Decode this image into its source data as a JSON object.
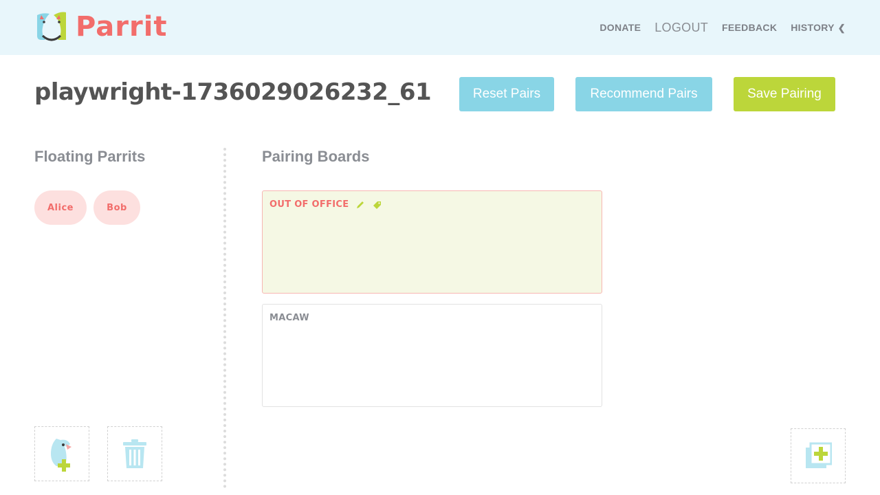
{
  "header": {
    "logo_text": "Parrit",
    "nav": {
      "donate": "DONATE",
      "logout": "LOGOUT",
      "feedback": "FEEDBACK",
      "history": "HISTORY",
      "history_chevron": "❮"
    }
  },
  "project": {
    "name": "playwright-1736029026232_61"
  },
  "actions": {
    "reset_label": "Reset Pairs",
    "recommend_label": "Recommend Pairs",
    "save_label": "Save Pairing"
  },
  "floating": {
    "title": "Floating Parrits",
    "people": [
      "Alice",
      "Bob"
    ]
  },
  "boards": {
    "title": "Pairing Boards",
    "items": [
      {
        "name": "OUT OF OFFICE",
        "exempt": true
      },
      {
        "name": "MACAW",
        "exempt": false
      }
    ]
  },
  "icons": {
    "logo": "parrot-logo-icon",
    "edit": "pencil-icon",
    "tag": "tag-icon",
    "add_person": "add-person-icon",
    "trash": "trash-icon",
    "add_board": "add-board-icon"
  },
  "colors": {
    "header_bg": "#e8f6fb",
    "brand_red": "#f26d6b",
    "accent_blue": "#89d5e6",
    "accent_green": "#bcd63a",
    "person_bg": "#fde0df",
    "ooo_board_bg": "#f5f8e4"
  }
}
